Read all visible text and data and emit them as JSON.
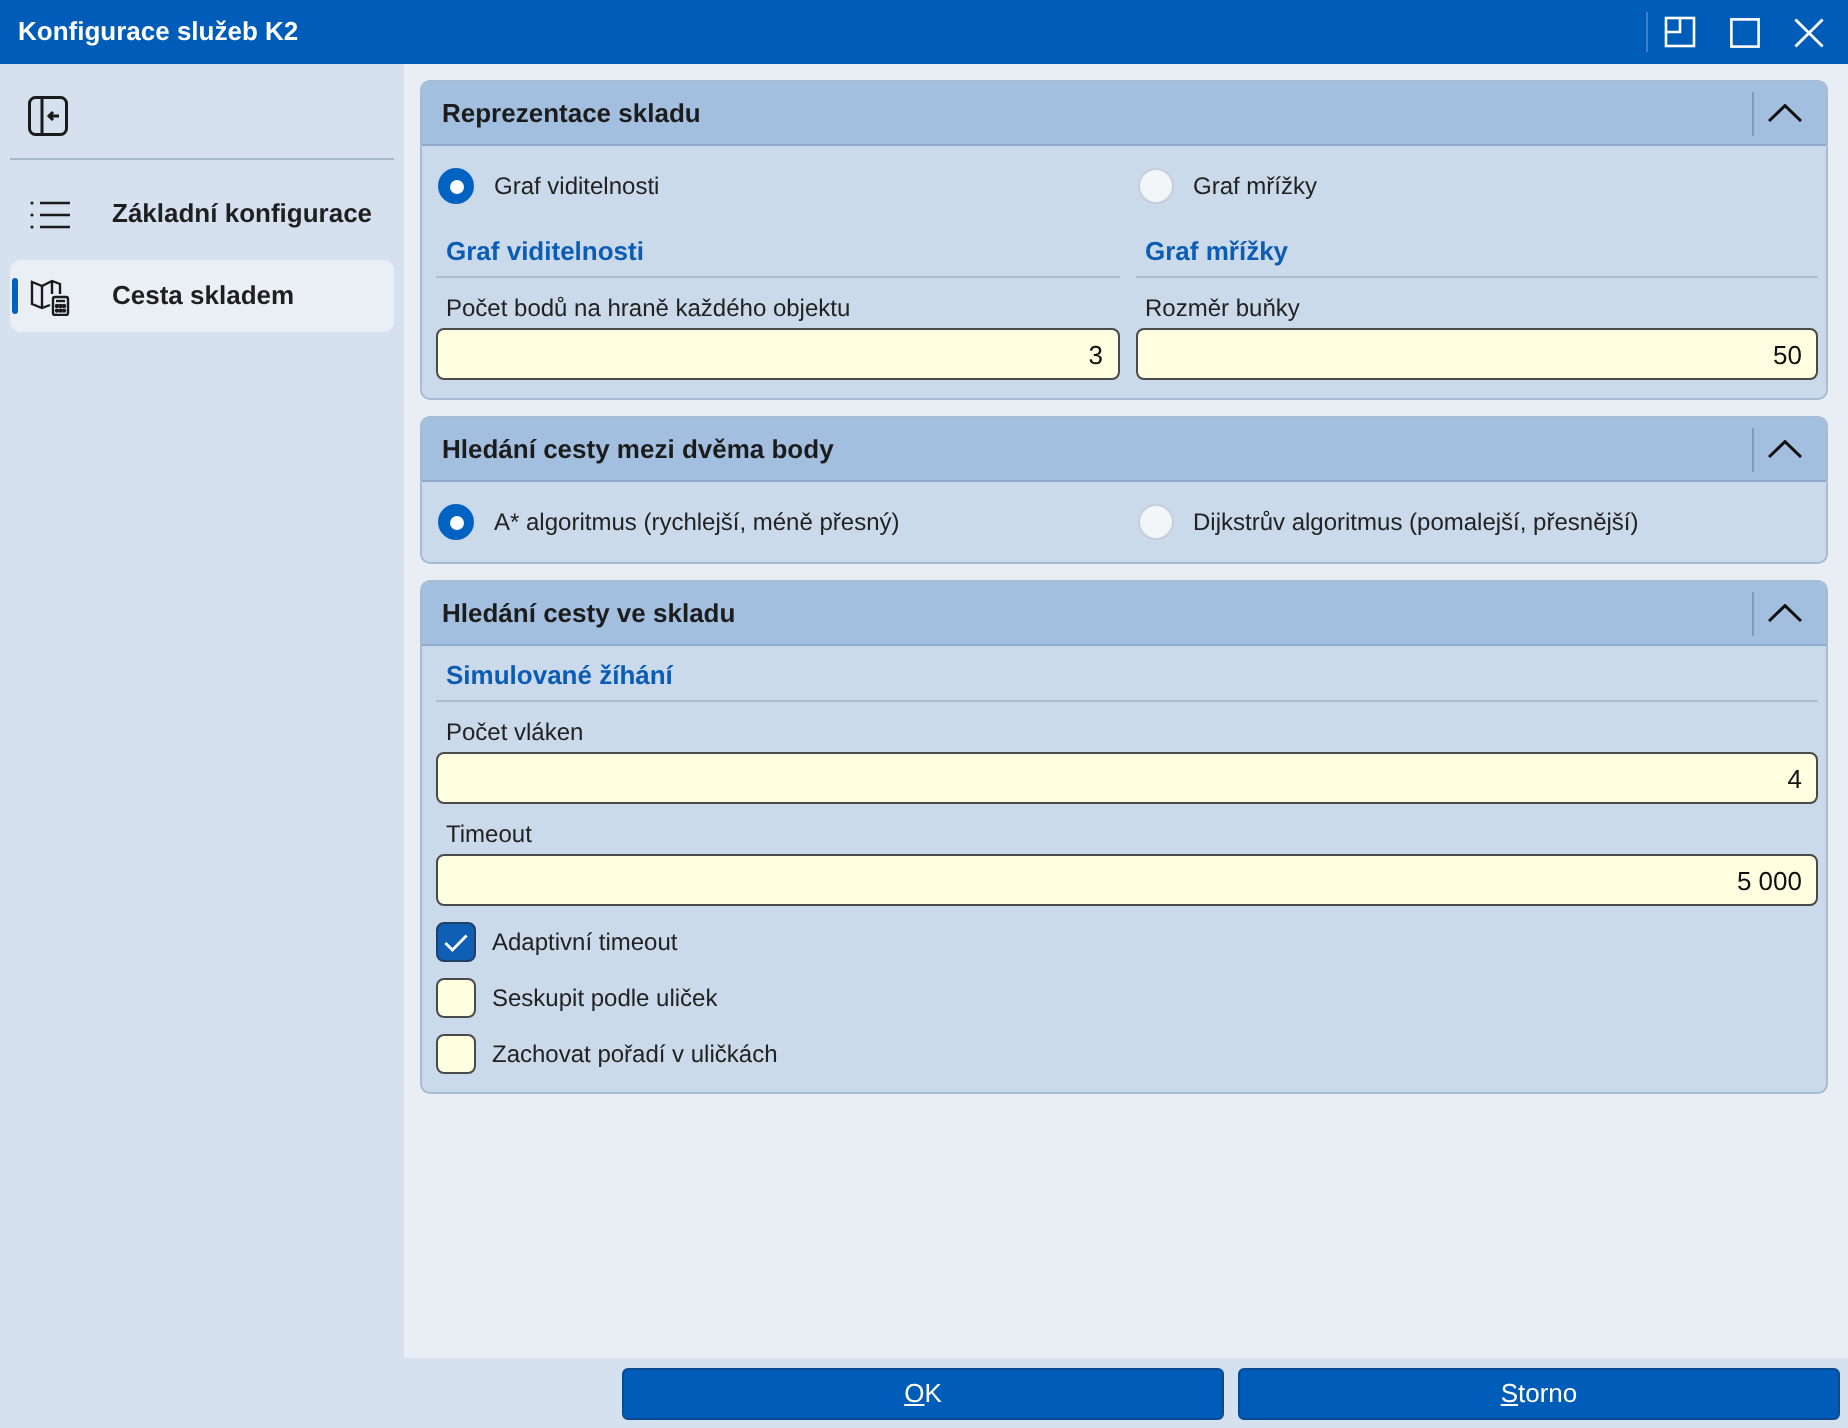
{
  "window": {
    "title": "Konfigurace služeb K2"
  },
  "sidebar": {
    "items": [
      {
        "label": "Základní konfigurace",
        "kind": "list",
        "selected": false
      },
      {
        "label": "Cesta skladem",
        "kind": "map",
        "selected": true
      }
    ]
  },
  "sections": [
    {
      "title": "Reprezentace skladu",
      "expanded": true,
      "rows": [
        {
          "kind": "radios",
          "options": [
            {
              "label": "Graf viditelnosti",
              "selected": true
            },
            {
              "label": "Graf mřížky",
              "selected": false
            }
          ]
        },
        {
          "kind": "columns",
          "columns": [
            {
              "heading": "Graf viditelnosti",
              "fields": [
                {
                  "label": "Počet bodů na hraně každého objektu",
                  "value": "3"
                }
              ]
            },
            {
              "heading": "Graf mřížky",
              "fields": [
                {
                  "label": "Rozměr buňky",
                  "value": "50"
                }
              ]
            }
          ]
        }
      ]
    },
    {
      "title": "Hledání cesty mezi dvěma body",
      "expanded": true,
      "rows": [
        {
          "kind": "radios",
          "options": [
            {
              "label": "A* algoritmus (rychlejší, méně přesný)",
              "selected": true
            },
            {
              "label": "Dijkstrův algoritmus (pomalejší, přesnější)",
              "selected": false
            }
          ]
        }
      ]
    },
    {
      "title": "Hledání cesty ve skladu",
      "expanded": true,
      "rows": [
        {
          "kind": "heading",
          "text": "Simulované žíhání"
        },
        {
          "kind": "field",
          "label": "Počet vláken",
          "value": "4"
        },
        {
          "kind": "field",
          "label": "Timeout",
          "value": "5 000"
        },
        {
          "kind": "checkbox",
          "label": "Adaptivní timeout",
          "checked": true
        },
        {
          "kind": "checkbox",
          "label": "Seskupit podle uliček",
          "checked": false
        },
        {
          "kind": "checkbox",
          "label": "Zachovat pořadí v uličkách",
          "checked": false
        }
      ]
    }
  ],
  "buttons": [
    {
      "label": "OK",
      "underline_first": true
    },
    {
      "label": "Storno",
      "underline_first": true
    }
  ]
}
